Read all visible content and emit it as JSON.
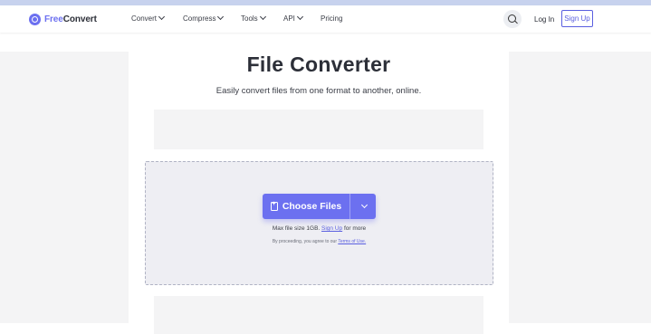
{
  "brand": {
    "name_part1": "Free",
    "name_part2": "Convert"
  },
  "nav": {
    "items": [
      {
        "label": "Convert"
      },
      {
        "label": "Compress"
      },
      {
        "label": "Tools"
      },
      {
        "label": "API"
      },
      {
        "label": "Pricing"
      }
    ],
    "login_label": "Log In",
    "signup_label": "Sign Up"
  },
  "hero": {
    "title": "File Converter",
    "subtitle": "Easily convert files from one format to another, online."
  },
  "uploader": {
    "choose_label": "Choose Files",
    "max_prefix": "Max file size 1GB.",
    "max_link": "Sign Up",
    "max_suffix": "for more",
    "terms_prefix": "By proceeding, you agree to our",
    "terms_link": "Terms of Use."
  },
  "colors": {
    "accent": "#6c70f0",
    "ad_bg": "#f4f4f5",
    "drop_bg": "#eeeef3"
  }
}
